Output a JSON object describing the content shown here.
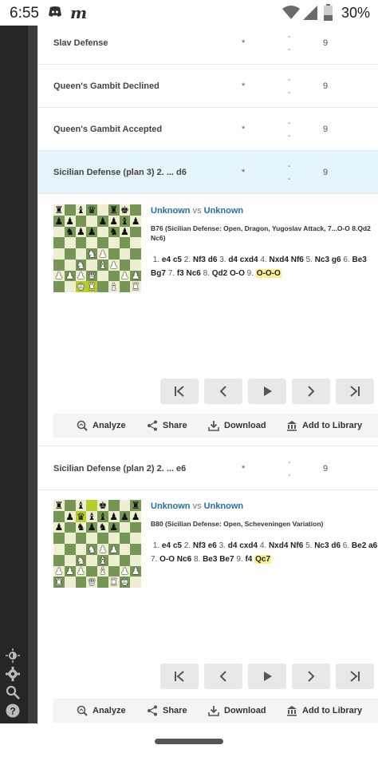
{
  "status_bar": {
    "time": "6:55",
    "app2_glyph": "m",
    "battery": "30%"
  },
  "rows": [
    {
      "name": "Slav Defense",
      "star": "*",
      "dash1": "-",
      "dash2": "-",
      "count": "9"
    },
    {
      "name": "Queen's Gambit Declined",
      "star": "*",
      "dash1": "-",
      "dash2": "-",
      "count": "9"
    },
    {
      "name": "Queen's Gambit Accepted",
      "star": "*",
      "dash1": "-",
      "dash2": "-",
      "count": "9"
    },
    {
      "name": "Sicilian Defense (plan 3) 2. ... d6",
      "star": "*",
      "dash1": "-",
      "dash2": "-",
      "count": "9"
    },
    {
      "name": "Sicilian Defense (plan 2) 2. ... e6",
      "star": "*",
      "dash1": "-",
      "dash2": "-",
      "count": "9"
    }
  ],
  "games": [
    {
      "white": "Unknown",
      "vs": "vs",
      "black": "Unknown",
      "eco": "B76 (Sicilian Defense: Open, Dragon, Yugoslav Attack, 7...O-O 8.Qd2 Nc6)",
      "moves": [
        {
          "n": "1.",
          "w": "e4",
          "b": "c5"
        },
        {
          "n": "2.",
          "w": "Nf3",
          "b": "d6"
        },
        {
          "n": "3.",
          "w": "d4",
          "b": "cxd4"
        },
        {
          "n": "4.",
          "w": "Nxd4",
          "b": "Nf6"
        },
        {
          "n": "5.",
          "w": "Nc3",
          "b": "g6"
        },
        {
          "n": "6.",
          "w": "Be3",
          "b": "Bg7"
        },
        {
          "n": "7.",
          "w": "f3",
          "b": "Nc6"
        },
        {
          "n": "8.",
          "w": "Qd2",
          "b": "O-O"
        },
        {
          "n": "9.",
          "w": "O-O-O",
          "b": ""
        }
      ],
      "board": [
        "r.bq.rk.",
        "pp..ppbp",
        ".npp.np.",
        "........",
        "...NP...",
        "..N.BP..",
        "PPPQ..PP",
        "..KR.B.R"
      ],
      "highlight": [
        "c1",
        "d1"
      ]
    },
    {
      "white": "Unknown",
      "vs": "vs",
      "black": "Unknown",
      "eco": "B80 (Sicilian Defense: Open, Scheveningen Variation)",
      "moves": [
        {
          "n": "1.",
          "w": "e4",
          "b": "c5"
        },
        {
          "n": "2.",
          "w": "Nf3",
          "b": "e6"
        },
        {
          "n": "3.",
          "w": "d4",
          "b": "cxd4"
        },
        {
          "n": "4.",
          "w": "Nxd4",
          "b": "Nf6"
        },
        {
          "n": "5.",
          "w": "Nc3",
          "b": "d6"
        },
        {
          "n": "6.",
          "w": "Be2",
          "b": "a6"
        },
        {
          "n": "7.",
          "w": "O-O",
          "b": "Nc6"
        },
        {
          "n": "8.",
          "w": "Be3",
          "b": "Be7"
        },
        {
          "n": "9.",
          "w": "f4",
          "b": "Qc7"
        }
      ],
      "board": [
        "r.b.k..r",
        ".pqbbppp",
        "p.npnp..",
        "........",
        "...NPP..",
        "..N.B...",
        "PPP.B.PP",
        "R..Q.RK."
      ],
      "highlight": [
        "c7",
        "d8"
      ]
    }
  ],
  "actions": {
    "analyze": "Analyze",
    "share": "Share",
    "download": "Download",
    "add_library": "Add to Library"
  },
  "colors": {
    "link": "#2a6bab",
    "highlight_row": "#e5f4fa",
    "board_light": "#eeeed2",
    "board_dark": "#769656",
    "move_highlight": "#f8f08a"
  }
}
